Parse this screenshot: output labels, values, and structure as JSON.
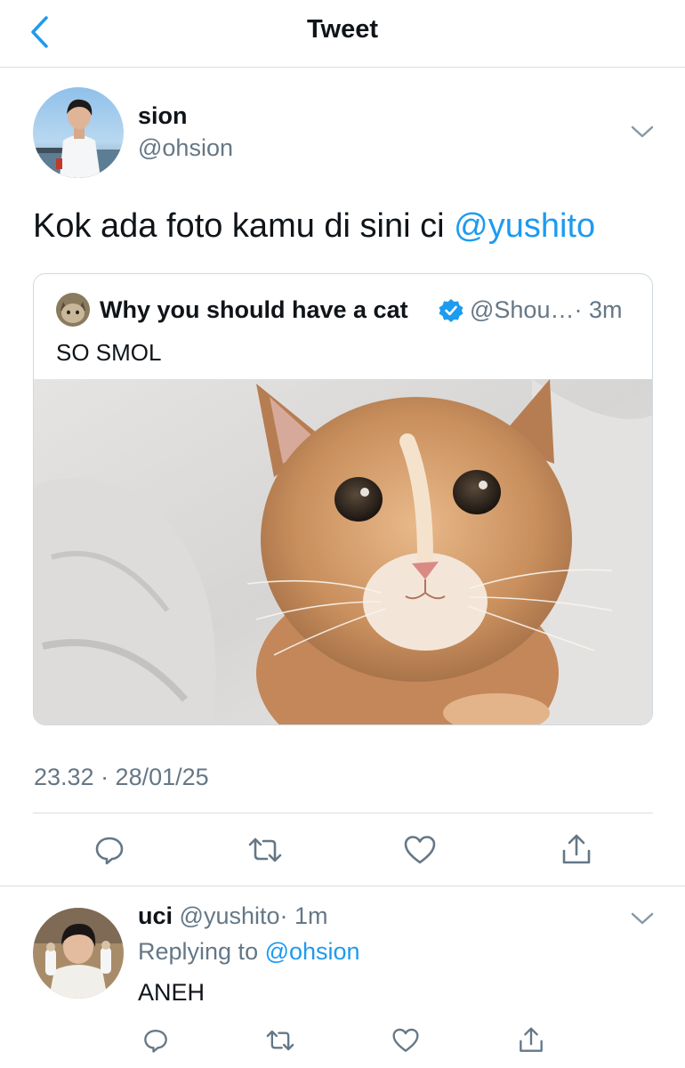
{
  "header": {
    "title": "Tweet",
    "back_icon": "chevron-left-icon"
  },
  "tweet": {
    "name": "sion",
    "handle": "@ohsion",
    "text": "Kok ada foto kamu di sini ci ",
    "mention": "@yushito",
    "timestamp": "23.32 · 28/01/25"
  },
  "quote": {
    "name": "Why you should have a cat",
    "handle": "@Shou…",
    "time": "· 3m",
    "text": "SO SMOL"
  },
  "reply": {
    "name": "uci",
    "handle": "@yushito",
    "time": "· 1m",
    "replying_prefix": "Replying to ",
    "replying_mention": "@ohsion",
    "text": "ANEH"
  },
  "colors": {
    "accent": "#1d9bf0",
    "muted": "#657786",
    "divider": "#d9dde0",
    "text": "#0f1419"
  },
  "icons": [
    "comment-icon",
    "retweet-icon",
    "like-icon",
    "share-icon",
    "verified-badge-icon",
    "chevron-down-icon"
  ]
}
